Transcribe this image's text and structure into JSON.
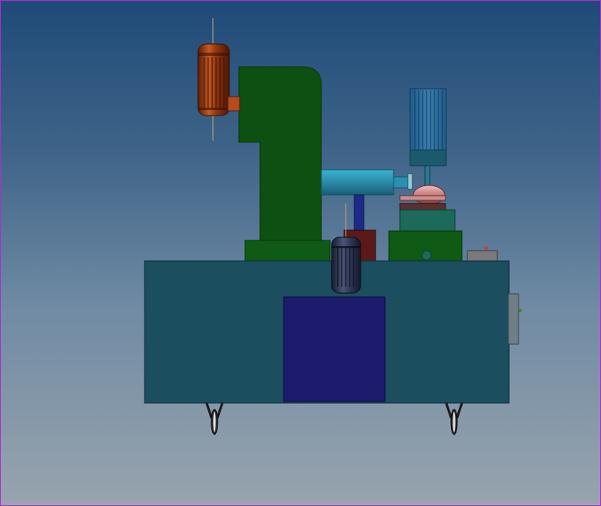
{
  "colors": {
    "frame_border": "#b12bd0",
    "background_top": "#1f4a78",
    "background_bottom": "#98a4ae",
    "base_body": "#1b4e5e",
    "access_panel": "#1d1b6b",
    "column": "#0e4f12",
    "motor_copper": "#9a3a12",
    "motor_dark": "#2e3552",
    "spindle": "#2a90b0",
    "gear_pink": "#c88a8a",
    "guard_blue": "#2d6ea0"
  },
  "icons": {
    "top_motor": "electric-motor-icon",
    "small_motor": "electric-motor-icon",
    "caster": "caster-wheel-icon"
  }
}
